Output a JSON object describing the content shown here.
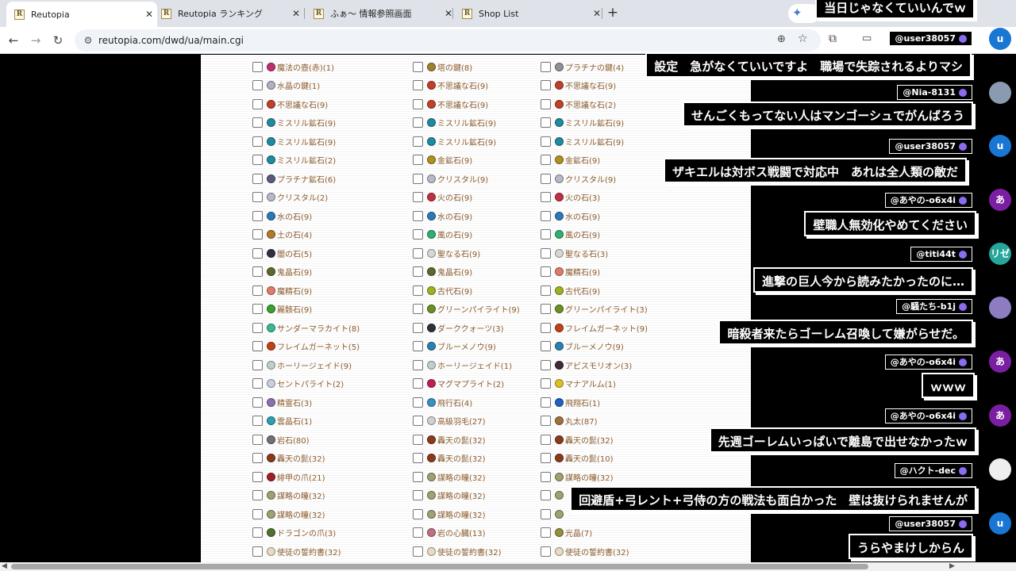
{
  "tabs": [
    {
      "label": "Reutopia",
      "favicon": "R",
      "active": true
    },
    {
      "label": "Reutopia ランキング",
      "favicon": "R",
      "active": false
    },
    {
      "label": "ふぁ～ 情報参照画面",
      "favicon": "R",
      "active": false
    },
    {
      "label": "Shop List",
      "favicon": "R",
      "active": false
    }
  ],
  "tab_close_glyph": "✕",
  "new_tab_glyph": "+",
  "gemini_glyph": "✦",
  "toolbar": {
    "back_glyph": "←",
    "forward_glyph": "→",
    "reload_glyph": "↻",
    "url": "reutopia.com/dwd/ua/main.cgi",
    "icons": [
      "site-info-icon",
      "zoom-icon",
      "bookmark-star-icon",
      "extensions-icon",
      "side-panel-icon"
    ]
  },
  "items": {
    "col1": [
      {
        "name": "魔法の壺(赤)(1)",
        "color": "#c0306a"
      },
      {
        "name": "水晶の鍵(1)",
        "color": "#b0b0c0"
      },
      {
        "name": "不思議な石(9)",
        "color": "#c0402a"
      },
      {
        "name": "ミスリル鉱石(9)",
        "color": "#1f8aa0"
      },
      {
        "name": "ミスリル鉱石(9)",
        "color": "#1f8aa0"
      },
      {
        "name": "ミスリル鉱石(2)",
        "color": "#1f8aa0"
      },
      {
        "name": "プラチナ鉱石(6)",
        "color": "#5a5a80"
      },
      {
        "name": "クリスタル(2)",
        "color": "#b8b8c8"
      },
      {
        "name": "水の石(9)",
        "color": "#2a7ab8"
      },
      {
        "name": "土の石(4)",
        "color": "#b07a2a"
      },
      {
        "name": "闇の石(5)",
        "color": "#303040"
      },
      {
        "name": "鬼晶石(9)",
        "color": "#5a6a2a"
      },
      {
        "name": "魔精石(9)",
        "color": "#e07a6a"
      },
      {
        "name": "麗骸石(9)",
        "color": "#3aa030"
      },
      {
        "name": "サンダーマラカイト(8)",
        "color": "#3ab890"
      },
      {
        "name": "フレイムガーネット(5)",
        "color": "#c0401a"
      },
      {
        "name": "ホーリージェイド(9)",
        "color": "#c0d0c8"
      },
      {
        "name": "セントパライト(2)",
        "color": "#c8d0e0"
      },
      {
        "name": "精霊石(3)",
        "color": "#8a70b0"
      },
      {
        "name": "雲晶石(1)",
        "color": "#2aa0b0"
      },
      {
        "name": "岩石(80)",
        "color": "#707078"
      },
      {
        "name": "轟天の髭(32)",
        "color": "#8a3a1a"
      },
      {
        "name": "緋甲の爪(21)",
        "color": "#a02020"
      },
      {
        "name": "謀略の瞳(32)",
        "color": "#a0a070"
      },
      {
        "name": "謀略の瞳(32)",
        "color": "#a0a070"
      },
      {
        "name": "ドラゴンの爪(3)",
        "color": "#507030"
      },
      {
        "name": "使徒の誓約書(32)",
        "color": "#e8dcc0"
      }
    ],
    "col2": [
      {
        "name": "塔の鍵(8)",
        "color": "#a08030"
      },
      {
        "name": "不思議な石(9)",
        "color": "#c0402a"
      },
      {
        "name": "不思議な石(9)",
        "color": "#c0402a"
      },
      {
        "name": "ミスリル鉱石(9)",
        "color": "#1f8aa0"
      },
      {
        "name": "ミスリル鉱石(9)",
        "color": "#1f8aa0"
      },
      {
        "name": "金鉱石(9)",
        "color": "#b09020"
      },
      {
        "name": "クリスタル(9)",
        "color": "#b8b8c8"
      },
      {
        "name": "火の石(9)",
        "color": "#c03040"
      },
      {
        "name": "水の石(9)",
        "color": "#2a7ab8"
      },
      {
        "name": "風の石(9)",
        "color": "#30b070"
      },
      {
        "name": "聖なる石(9)",
        "color": "#d8d8d0"
      },
      {
        "name": "鬼晶石(9)",
        "color": "#5a6a2a"
      },
      {
        "name": "古代石(9)",
        "color": "#a0b020"
      },
      {
        "name": "グリーンパイライト(9)",
        "color": "#6a9020"
      },
      {
        "name": "ダーククォーツ(3)",
        "color": "#303038"
      },
      {
        "name": "ブルーメノウ(9)",
        "color": "#2a80b0"
      },
      {
        "name": "ホーリージェイド(1)",
        "color": "#c0d0c8"
      },
      {
        "name": "マグマプライト(2)",
        "color": "#c02050"
      },
      {
        "name": "飛行石(4)",
        "color": "#3a90c0"
      },
      {
        "name": "高級羽毛(27)",
        "color": "#d0d0d0"
      },
      {
        "name": "轟天の髭(32)",
        "color": "#8a3a1a"
      },
      {
        "name": "轟天の髭(32)",
        "color": "#8a3a1a"
      },
      {
        "name": "謀略の瞳(32)",
        "color": "#a0a070"
      },
      {
        "name": "謀略の瞳(32)",
        "color": "#a0a070"
      },
      {
        "name": "謀略の瞳(32)",
        "color": "#a0a070"
      },
      {
        "name": "岩の心臓(13)",
        "color": "#c07080"
      },
      {
        "name": "使徒の誓約書(32)",
        "color": "#e8dcc0"
      }
    ],
    "col3": [
      {
        "name": "プラチナの鍵(4)",
        "color": "#909098"
      },
      {
        "name": "不思議な石(9)",
        "color": "#c0402a"
      },
      {
        "name": "不思議な石(2)",
        "color": "#c0402a"
      },
      {
        "name": "ミスリル鉱石(9)",
        "color": "#1f8aa0"
      },
      {
        "name": "ミスリル鉱石(9)",
        "color": "#1f8aa0"
      },
      {
        "name": "金鉱石(9)",
        "color": "#b09020"
      },
      {
        "name": "クリスタル(9)",
        "color": "#b8b8c8"
      },
      {
        "name": "火の石(3)",
        "color": "#c03040"
      },
      {
        "name": "水の石(9)",
        "color": "#2a7ab8"
      },
      {
        "name": "風の石(9)",
        "color": "#30b070"
      },
      {
        "name": "聖なる石(3)",
        "color": "#d8d8d0"
      },
      {
        "name": "魔精石(9)",
        "color": "#e07a6a"
      },
      {
        "name": "古代石(9)",
        "color": "#a0b020"
      },
      {
        "name": "グリーンパイライト(3)",
        "color": "#6a9020"
      },
      {
        "name": "フレイムガーネット(9)",
        "color": "#c0401a"
      },
      {
        "name": "ブルーメノウ(9)",
        "color": "#2a80b0"
      },
      {
        "name": "アビスモリオン(3)",
        "color": "#402838"
      },
      {
        "name": "マナアルム(1)",
        "color": "#e0c020"
      },
      {
        "name": "飛翔石(1)",
        "color": "#2060c0"
      },
      {
        "name": "丸太(87)",
        "color": "#a07040"
      },
      {
        "name": "轟天の髭(32)",
        "color": "#8a3a1a"
      },
      {
        "name": "轟天の髭(10)",
        "color": "#8a3a1a"
      },
      {
        "name": "謀略の瞳(32)",
        "color": "#a0a070"
      },
      {
        "name": "",
        "color": "#a0a070"
      },
      {
        "name": "",
        "color": "#a0a070"
      },
      {
        "name": "光晶(7)",
        "color": "#909040"
      },
      {
        "name": "使徒の誓約書(32)",
        "color": "#e8dcc0"
      }
    ]
  },
  "chat": [
    {
      "text": "当日じゃなくていいんでｗ",
      "handle": "",
      "avatar": ""
    },
    {
      "text": "設定　急がなくていいですよ　職場で失踪されるよりマシ",
      "handle": "@user38057",
      "avatar": "u",
      "avatar_color": "#1976d2"
    },
    {
      "text": "せんごくもってない人はマンゴーシュでがんばろう",
      "handle": "@Nia-8131",
      "avatar": "",
      "avatar_color": "#8a9ab0"
    },
    {
      "text": "ザキエルは対ボス戦闘で対応中　あれは全人類の敵だ",
      "handle": "@user38057",
      "avatar": "u",
      "avatar_color": "#1976d2"
    },
    {
      "text": "壁職人無効化やめてください",
      "handle": "@あやの-o6x4i",
      "avatar": "あ",
      "avatar_color": "#7b1fa2"
    },
    {
      "text": "進撃の巨人今から読みたかったのに…",
      "handle": "@titi44t",
      "avatar": "リゼ",
      "avatar_color": "#26a69a"
    },
    {
      "text": "暗殺者来たらゴーレム召喚して嫌がらせだ。",
      "handle": "@騒たち-b1j",
      "avatar": "",
      "avatar_color": "#8e7cc3"
    },
    {
      "text": "ｗｗｗ",
      "handle": "@あやの-o6x4i",
      "avatar": "あ",
      "avatar_color": "#7b1fa2"
    },
    {
      "text": "先週ゴーレムいっぱいで離島で出せなかったｗ",
      "handle": "@あやの-o6x4i",
      "avatar": "あ",
      "avatar_color": "#7b1fa2"
    },
    {
      "text": "回避盾+弓レント+弓侍の方の戦法も面白かった　壁は抜けられませんが",
      "handle": "@ハクト-dec",
      "avatar": "",
      "avatar_color": "#eeeeee"
    },
    {
      "text": "うらやまけしからん",
      "handle": "@user38057",
      "avatar": "u",
      "avatar_color": "#1976d2"
    }
  ]
}
